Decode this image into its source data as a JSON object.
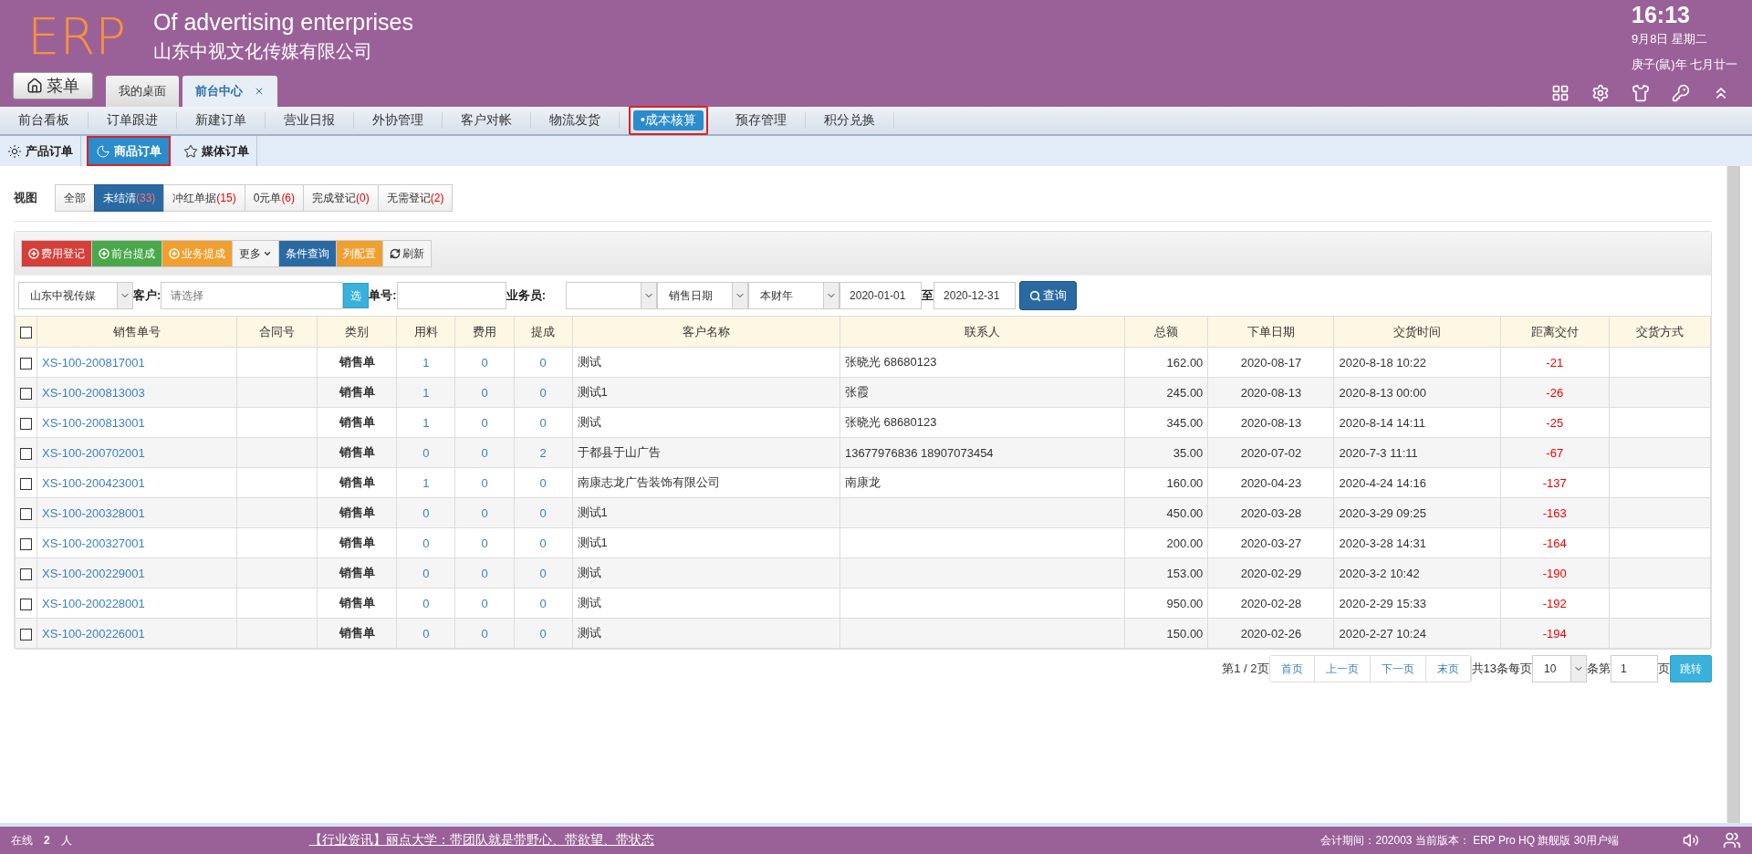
{
  "header": {
    "logo": "ERP",
    "title": "Of advertising enterprises",
    "company": "山东中视文化传媒有限公司",
    "menu_button": "菜单",
    "tabs": [
      {
        "label": "我的桌面",
        "selected": false
      },
      {
        "label": "前台中心",
        "selected": true
      }
    ],
    "clock": {
      "time": "16:13",
      "date": "9月8日 星期二",
      "lunar": "庚子(鼠)年 七月廿一"
    }
  },
  "nav": [
    {
      "label": "前台看板",
      "selected": false
    },
    {
      "label": "订单跟进",
      "selected": false
    },
    {
      "label": "新建订单",
      "selected": false
    },
    {
      "label": "营业日报",
      "selected": false
    },
    {
      "label": "外协管理",
      "selected": false
    },
    {
      "label": "客户对帐",
      "selected": false
    },
    {
      "label": "物流发货",
      "selected": false
    },
    {
      "label": "•成本核算",
      "selected": true
    },
    {
      "label": "预存管理",
      "selected": false
    },
    {
      "label": "积分兑换",
      "selected": false
    }
  ],
  "subtabs": [
    {
      "label": "产品订单",
      "kind": "sun",
      "selected": false
    },
    {
      "label": "商品订单",
      "kind": "moon",
      "selected": true
    },
    {
      "label": "媒体订单",
      "kind": "star",
      "selected": false
    }
  ],
  "view": {
    "label": "视图",
    "filters": [
      {
        "label": "全部",
        "selected": false
      },
      {
        "label": "未结清",
        "count": "(33)",
        "selected": true
      },
      {
        "label": "冲红单据",
        "count": "(15)",
        "selected": false
      },
      {
        "label": "0元单",
        "count": "(6)",
        "selected": false
      },
      {
        "label": "完成登记",
        "count": "(0)",
        "selected": false
      },
      {
        "label": "无需登记",
        "count": "(2)",
        "selected": false
      }
    ]
  },
  "toolbar": [
    {
      "label": "费用登记",
      "kind": "danger"
    },
    {
      "label": "前台提成",
      "kind": "success"
    },
    {
      "label": "业务提成",
      "kind": "warning"
    },
    {
      "label": "更多",
      "kind": "default"
    },
    {
      "label": "条件查询",
      "kind": "primary"
    },
    {
      "label": "列配置",
      "kind": "warning"
    },
    {
      "label": "刷新",
      "kind": "default"
    }
  ],
  "search": {
    "company": "山东中视传媒",
    "customer_label": "客户:",
    "customer_placeholder": "请选择",
    "pick_button": "选",
    "order_label": "单号:",
    "salesman_label": "业务员:",
    "date_type": "销售日期",
    "period": "本财年",
    "date_from": "2020-01-01",
    "to_label": "至",
    "date_to": "2020-12-31",
    "query_button": "查询"
  },
  "table": {
    "select_all": {
      "checked": false
    },
    "columns": [
      "销售单号",
      "合同号",
      "类别",
      "用料",
      "费用",
      "提成",
      "客户名称",
      "联系人",
      "总额",
      "下单日期",
      "交货时间",
      "距离交付",
      "交货方式"
    ],
    "rows": [
      {
        "checked": false,
        "cells": [
          "XS-100-200817001",
          "",
          "销售单",
          "1",
          "0",
          "0",
          "测试",
          "张晓光 68680123",
          "162.00",
          "2020-08-17",
          "2020-8-18 10:22",
          "-21",
          ""
        ]
      },
      {
        "checked": false,
        "cells": [
          "XS-100-200813003",
          "",
          "销售单",
          "1",
          "0",
          "0",
          "测试1",
          "张霞",
          "245.00",
          "2020-08-13",
          "2020-8-13 00:00",
          "-26",
          ""
        ]
      },
      {
        "checked": false,
        "cells": [
          "XS-100-200813001",
          "",
          "销售单",
          "1",
          "0",
          "0",
          "测试",
          "张晓光 68680123",
          "345.00",
          "2020-08-13",
          "2020-8-14 14:11",
          "-25",
          ""
        ]
      },
      {
        "checked": false,
        "cells": [
          "XS-100-200702001",
          "",
          "销售单",
          "0",
          "0",
          "2",
          "于都县于山广告",
          "13677976836 18907073454",
          "35.00",
          "2020-07-02",
          "2020-7-3 11:11",
          "-67",
          ""
        ]
      },
      {
        "checked": false,
        "cells": [
          "XS-100-200423001",
          "",
          "销售单",
          "1",
          "0",
          "0",
          "南康志龙广告装饰有限公司",
          "南康龙",
          "160.00",
          "2020-04-23",
          "2020-4-24 14:16",
          "-137",
          ""
        ]
      },
      {
        "checked": false,
        "cells": [
          "XS-100-200328001",
          "",
          "销售单",
          "0",
          "0",
          "0",
          "测试1",
          "",
          "450.00",
          "2020-03-28",
          "2020-3-29 09:25",
          "-163",
          ""
        ]
      },
      {
        "checked": false,
        "cells": [
          "XS-100-200327001",
          "",
          "销售单",
          "0",
          "0",
          "0",
          "测试1",
          "",
          "200.00",
          "2020-03-27",
          "2020-3-28 14:31",
          "-164",
          ""
        ]
      },
      {
        "checked": false,
        "cells": [
          "XS-100-200229001",
          "",
          "销售单",
          "0",
          "0",
          "0",
          "测试",
          "",
          "153.00",
          "2020-02-29",
          "2020-3-2 10:42",
          "-190",
          ""
        ]
      },
      {
        "checked": false,
        "cells": [
          "XS-100-200228001",
          "",
          "销售单",
          "0",
          "0",
          "0",
          "测试",
          "",
          "950.00",
          "2020-02-28",
          "2020-2-29 15:33",
          "-192",
          ""
        ]
      },
      {
        "checked": false,
        "cells": [
          "XS-100-200226001",
          "",
          "销售单",
          "0",
          "0",
          "0",
          "测试",
          "",
          "150.00",
          "2020-02-26",
          "2020-2-27 10:24",
          "-194",
          ""
        ]
      }
    ]
  },
  "pagination": {
    "page_info": "第1 / 2页",
    "buttons": [
      "首页",
      "上一页",
      "下一页",
      "末页"
    ],
    "total": "共13条每页",
    "page_size": "10",
    "goto_label": "条第",
    "page_input": "1",
    "page_suffix": "页",
    "go_button": "跳转"
  },
  "footer": {
    "online_label": "在线",
    "online_count": "2",
    "online_unit": "人",
    "news": "【行业资讯】丽点大学：带团队就是带野心、带欲望、带状态",
    "version": "会计期间：202003 当前版本： ERP Pro HQ 旗舰版 30用户端"
  }
}
